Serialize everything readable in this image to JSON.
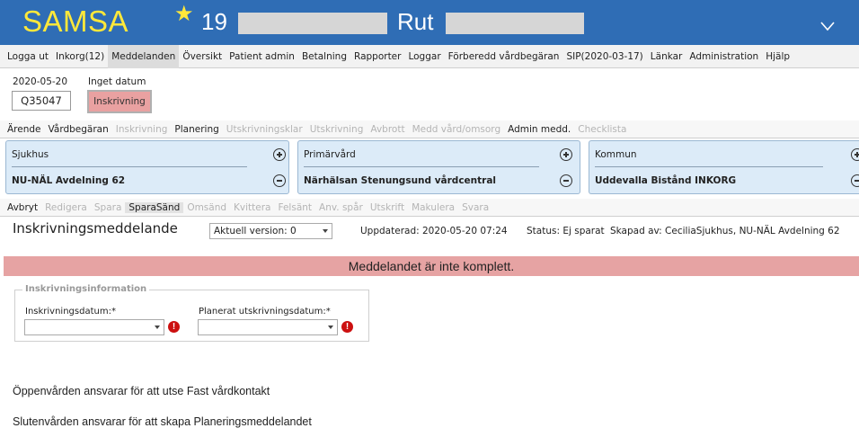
{
  "header": {
    "app_name": "SAMSA",
    "number": "19",
    "rut_label": "Rut"
  },
  "menu": [
    {
      "label": "Logga ut",
      "active": false
    },
    {
      "label": "Inkorg(12)",
      "active": false
    },
    {
      "label": "Meddelanden",
      "active": true
    },
    {
      "label": "Översikt",
      "active": false
    },
    {
      "label": "Patient admin",
      "active": false
    },
    {
      "label": "Betalning",
      "active": false
    },
    {
      "label": "Rapporter",
      "active": false
    },
    {
      "label": "Loggar",
      "active": false
    },
    {
      "label": "Förberedd vårdbegäran",
      "active": false
    },
    {
      "label": "SIP(2020-03-17)",
      "active": false
    },
    {
      "label": "Länkar",
      "active": false
    },
    {
      "label": "Administration",
      "active": false
    },
    {
      "label": "Hjälp",
      "active": false
    }
  ],
  "info": {
    "date": "2020-05-20",
    "id": "Q35047",
    "no_date": "Inget datum",
    "badge": "Inskrivning"
  },
  "tabs": [
    {
      "label": "Ärende",
      "state": "on"
    },
    {
      "label": "Vårdbegäran",
      "state": "on"
    },
    {
      "label": "Inskrivning",
      "state": "off"
    },
    {
      "label": "Planering",
      "state": "on"
    },
    {
      "label": "Utskrivningsklar",
      "state": "off"
    },
    {
      "label": "Utskrivning",
      "state": "off"
    },
    {
      "label": "Avbrott",
      "state": "off"
    },
    {
      "label": "Medd vård/omsorg",
      "state": "off"
    },
    {
      "label": "Admin medd.",
      "state": "on"
    },
    {
      "label": "Checklista",
      "state": "off"
    }
  ],
  "care_boxes": [
    {
      "label": "Sjukhus",
      "value": "NU-NÄL Avdelning 62"
    },
    {
      "label": "Primärvård",
      "value": "Närhälsan Stenungsund vårdcentral"
    },
    {
      "label": "Kommun",
      "value": "Uddevalla Bistånd INKORG"
    }
  ],
  "actions": [
    {
      "label": "Avbryt",
      "state": "on"
    },
    {
      "label": "Redigera",
      "state": "off"
    },
    {
      "label": "Spara",
      "state": "off"
    },
    {
      "label": "SparaSänd",
      "state": "act"
    },
    {
      "label": "Omsänd",
      "state": "off"
    },
    {
      "label": "Kvittera",
      "state": "off"
    },
    {
      "label": "Felsänt",
      "state": "off"
    },
    {
      "label": "Anv. spår",
      "state": "off"
    },
    {
      "label": "Utskrift",
      "state": "off"
    },
    {
      "label": "Makulera",
      "state": "off"
    },
    {
      "label": "Svara",
      "state": "off"
    }
  ],
  "message": {
    "title": "Inskrivningsmeddelande",
    "version": "Aktuell version: 0",
    "updated": "Uppdaterad: 2020-05-20 07:24",
    "status": "Status: Ej sparat",
    "created": "Skapad av: CeciliaSjukhus, NU-NÄL Avdelning 62"
  },
  "warning": "Meddelandet är inte komplett.",
  "form": {
    "legend": "Inskrivningsinformation",
    "field1_label": "Inskrivningsdatum:*",
    "field2_label": "Planerat utskrivningsdatum:*",
    "error_mark": "!"
  },
  "notes": [
    "Öppenvården ansvarar för att utse Fast vårdkontakt",
    "Slutenvården ansvarar för att skapa Planeringsmeddelandet"
  ]
}
